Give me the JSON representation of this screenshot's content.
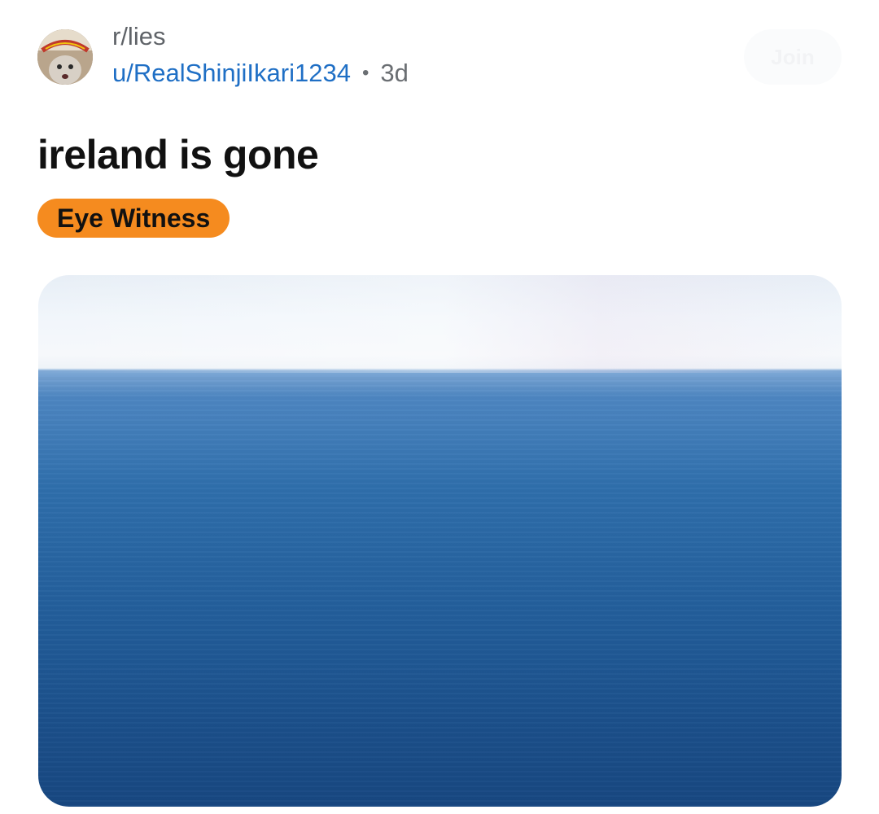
{
  "post": {
    "subreddit": "r/lies",
    "username": "u/RealShinjiIkari1234",
    "separator": "•",
    "age": "3d",
    "join_label": "Join",
    "title": "ireland is gone",
    "flair": {
      "label": "Eye Witness",
      "color": "#f58b1f"
    },
    "image_icon": "ocean-photo"
  },
  "colors": {
    "username": "#1f6fc5",
    "meta_gray": "#5f6368"
  }
}
